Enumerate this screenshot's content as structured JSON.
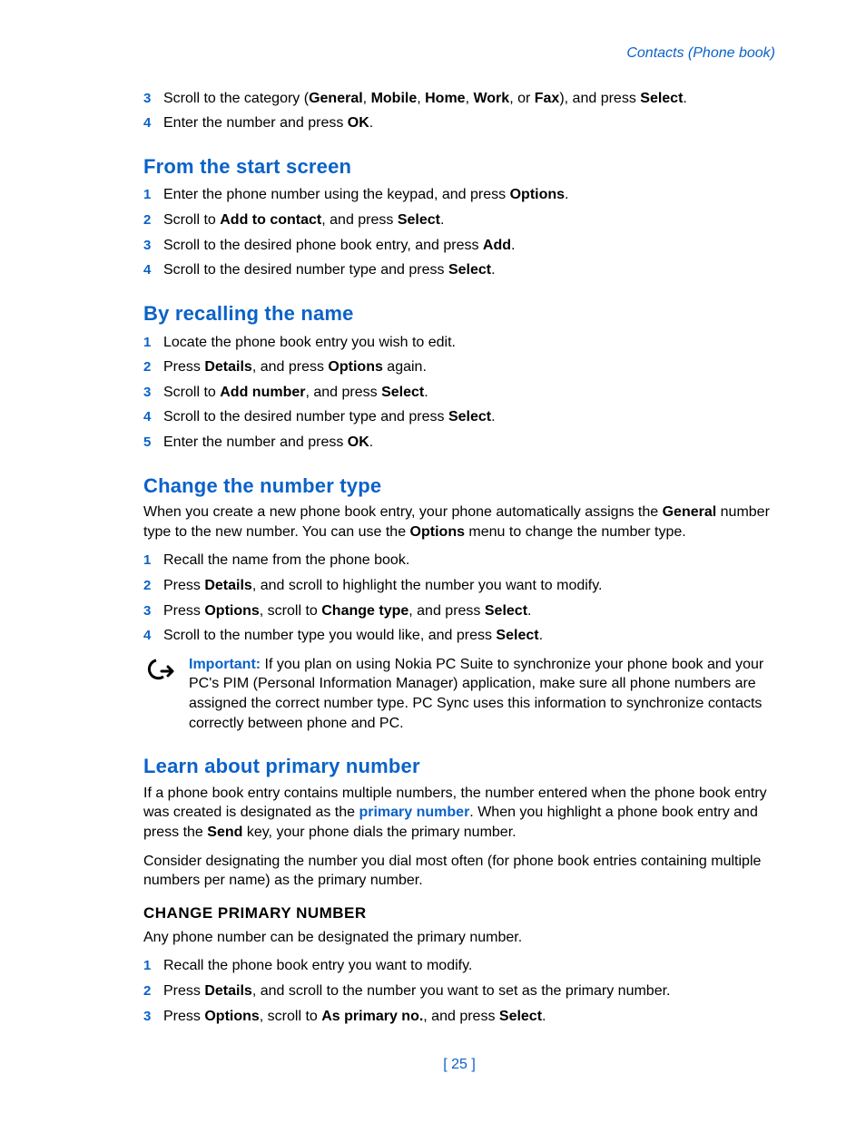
{
  "header": {
    "breadcrumb": "Contacts (Phone book)"
  },
  "intro_steps": [
    {
      "n": "3",
      "parts": [
        "Scroll to the category (",
        {
          "b": "General"
        },
        ", ",
        {
          "b": "Mobile"
        },
        ", ",
        {
          "b": "Home"
        },
        ", ",
        {
          "b": "Work"
        },
        ", or ",
        {
          "b": "Fax"
        },
        "), and press ",
        {
          "b": "Select"
        },
        "."
      ]
    },
    {
      "n": "4",
      "parts": [
        "Enter the number and press ",
        {
          "b": "OK"
        },
        "."
      ]
    }
  ],
  "sections": {
    "start": {
      "title": "From the start screen",
      "steps": [
        {
          "n": "1",
          "parts": [
            "Enter the phone number using the keypad, and press ",
            {
              "b": "Options"
            },
            "."
          ]
        },
        {
          "n": "2",
          "parts": [
            "Scroll to ",
            {
              "b": "Add to contact"
            },
            ", and press ",
            {
              "b": "Select"
            },
            "."
          ]
        },
        {
          "n": "3",
          "parts": [
            "Scroll to the desired phone book entry, and press ",
            {
              "b": "Add"
            },
            "."
          ]
        },
        {
          "n": "4",
          "parts": [
            "Scroll to the desired number type and press ",
            {
              "b": "Select"
            },
            "."
          ]
        }
      ]
    },
    "recall": {
      "title": "By recalling the name",
      "steps": [
        {
          "n": "1",
          "parts": [
            "Locate the phone book entry you wish to edit."
          ]
        },
        {
          "n": "2",
          "parts": [
            "Press ",
            {
              "b": "Details"
            },
            ", and press ",
            {
              "b": "Options"
            },
            " again."
          ]
        },
        {
          "n": "3",
          "parts": [
            "Scroll to ",
            {
              "b": "Add number"
            },
            ", and press ",
            {
              "b": "Select"
            },
            "."
          ]
        },
        {
          "n": "4",
          "parts": [
            "Scroll to the desired number type and press ",
            {
              "b": "Select"
            },
            "."
          ]
        },
        {
          "n": "5",
          "parts": [
            "Enter the number and press ",
            {
              "b": "OK"
            },
            "."
          ]
        }
      ]
    },
    "change_type": {
      "title": "Change the number type",
      "intro_parts": [
        "When you create a new phone book entry, your phone automatically assigns the ",
        {
          "b": "General"
        },
        " number type to the new number. You can use the ",
        {
          "b": "Options"
        },
        " menu to change the number type."
      ],
      "steps": [
        {
          "n": "1",
          "parts": [
            "Recall the name from the phone book."
          ]
        },
        {
          "n": "2",
          "parts": [
            "Press ",
            {
              "b": "Details"
            },
            ", and scroll to highlight the number you want to modify."
          ]
        },
        {
          "n": "3",
          "parts": [
            "Press ",
            {
              "b": "Options"
            },
            ", scroll to ",
            {
              "b": "Change type"
            },
            ", and press ",
            {
              "b": "Select"
            },
            "."
          ]
        },
        {
          "n": "4",
          "parts": [
            "Scroll to the number type you would like, and press ",
            {
              "b": "Select"
            },
            "."
          ]
        }
      ],
      "important": {
        "label": "Important:",
        "text": " If you plan on using Nokia PC Suite to synchronize your phone book and your PC's PIM (Personal Information Manager) application, make sure all phone numbers are assigned the correct number type. PC Sync uses this information to synchronize contacts correctly between phone and PC."
      }
    },
    "primary": {
      "title": "Learn about primary number",
      "para1_parts": [
        "If a phone book entry contains multiple numbers, the number entered when the phone book entry was created is designated as the ",
        {
          "term": "primary number"
        },
        ". When you highlight a phone book entry and press the ",
        {
          "b": "Send"
        },
        " key, your phone dials the primary number."
      ],
      "para2": "Consider designating the number you dial most often (for phone book entries containing multiple numbers per name) as the primary number.",
      "sub_title": "CHANGE PRIMARY NUMBER",
      "sub_intro": "Any phone number can be designated the primary number.",
      "steps": [
        {
          "n": "1",
          "parts": [
            "Recall the phone book entry you want to modify."
          ]
        },
        {
          "n": "2",
          "parts": [
            "Press ",
            {
              "b": "Details"
            },
            ", and scroll to the number you want to set as the primary number."
          ]
        },
        {
          "n": "3",
          "parts": [
            "Press ",
            {
              "b": "Options"
            },
            ", scroll to ",
            {
              "b": "As primary no."
            },
            ", and press ",
            {
              "b": "Select"
            },
            "."
          ]
        }
      ]
    }
  },
  "footer": {
    "page": "[ 25 ]"
  }
}
